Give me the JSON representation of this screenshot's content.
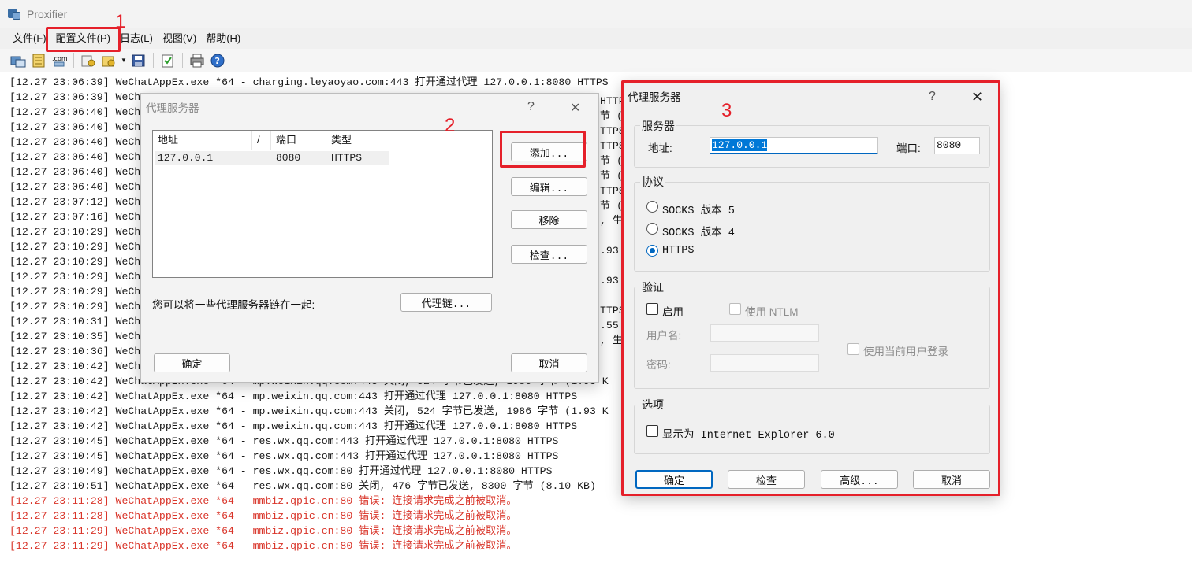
{
  "window": {
    "title": "Proxifier"
  },
  "menu": [
    "文件(F)",
    "配置文件(P)",
    "日志(L)",
    "视图(V)",
    "帮助(H)"
  ],
  "toolbar": [
    "new-profile-icon",
    "open-profile-icon",
    "domain-icon",
    "proxy-settings-icon",
    "rules-icon",
    "save-icon",
    "check-icon",
    "print-icon",
    "help-icon"
  ],
  "log": [
    {
      "t": "[12.27 23:06:39] WeChatAppEx.exe *64 - charging.leyaoyao.com:443 打开通过代理 127.0.0.1:8080 HTTPS",
      "err": false
    },
    {
      "t": "[12.27 23:06:39] WeCh",
      "err": false
    },
    {
      "t": "[12.27 23:06:40] WeCh",
      "err": false
    },
    {
      "t": "[12.27 23:06:40] WeCh",
      "err": false
    },
    {
      "t": "[12.27 23:06:40] WeCh",
      "err": false
    },
    {
      "t": "[12.27 23:06:40] WeCh",
      "err": false
    },
    {
      "t": "[12.27 23:06:40] WeCh",
      "err": false
    },
    {
      "t": "[12.27 23:06:40] WeCh",
      "err": false
    },
    {
      "t": "[12.27 23:07:12] WeCh",
      "err": false
    },
    {
      "t": "[12.27 23:07:16] WeCh",
      "err": false
    },
    {
      "t": "[12.27 23:10:29] WeCh",
      "err": false
    },
    {
      "t": "[12.27 23:10:29] WeCh",
      "err": false
    },
    {
      "t": "[12.27 23:10:29] WeCh",
      "err": false
    },
    {
      "t": "[12.27 23:10:29] WeCh",
      "err": false
    },
    {
      "t": "[12.27 23:10:29] WeCh",
      "err": false
    },
    {
      "t": "[12.27 23:10:29] WeCh",
      "err": false
    },
    {
      "t": "[12.27 23:10:31] WeCh",
      "err": false
    },
    {
      "t": "[12.27 23:10:35] WeCh",
      "err": false
    },
    {
      "t": "[12.27 23:10:36] WeCh",
      "err": false
    },
    {
      "t": "[12.27 23:10:42] WeCh",
      "err": false
    },
    {
      "t": "[12.27 23:10:42] WeChatAppEx.exe *64 - mp.weixin.qq.com:443 关闭, 524 字节已发送, 1986 字节 (1.93 K",
      "err": false
    },
    {
      "t": "[12.27 23:10:42] WeChatAppEx.exe *64 - mp.weixin.qq.com:443 打开通过代理 127.0.0.1:8080 HTTPS",
      "err": false
    },
    {
      "t": "[12.27 23:10:42] WeChatAppEx.exe *64 - mp.weixin.qq.com:443 关闭, 524 字节已发送, 1986 字节 (1.93 K",
      "err": false
    },
    {
      "t": "[12.27 23:10:42] WeChatAppEx.exe *64 - mp.weixin.qq.com:443 打开通过代理 127.0.0.1:8080 HTTPS",
      "err": false
    },
    {
      "t": "[12.27 23:10:45] WeChatAppEx.exe *64 - res.wx.qq.com:443 打开通过代理 127.0.0.1:8080 HTTPS",
      "err": false
    },
    {
      "t": "[12.27 23:10:45] WeChatAppEx.exe *64 - res.wx.qq.com:443 打开通过代理 127.0.0.1:8080 HTTPS",
      "err": false
    },
    {
      "t": "[12.27 23:10:49] WeChatAppEx.exe *64 - res.wx.qq.com:80 打开通过代理 127.0.0.1:8080 HTTPS",
      "err": false
    },
    {
      "t": "[12.27 23:10:51] WeChatAppEx.exe *64 - res.wx.qq.com:80 关闭, 476 字节已发送, 8300 字节 (8.10 KB)",
      "err": false
    },
    {
      "t": "[12.27 23:11:28] WeChatAppEx.exe *64 - mmbiz.qpic.cn:80 错误: 连接请求完成之前被取消。",
      "err": true
    },
    {
      "t": "[12.27 23:11:28] WeChatAppEx.exe *64 - mmbiz.qpic.cn:80 错误: 连接请求完成之前被取消。",
      "err": true
    },
    {
      "t": "[12.27 23:11:29] WeChatAppEx.exe *64 - mmbiz.qpic.cn:80 错误: 连接请求完成之前被取消。",
      "err": true
    },
    {
      "t": "[12.27 23:11:29] WeChatAppEx.exe *64 - mmbiz.qpic.cn:80 错误: 连接请求完成之前被取消。",
      "err": true
    }
  ],
  "log_fragments": [
    "HTTPS",
    "节 (1",
    "TTPS",
    "TTPS",
    "节 (1",
    "节 (1",
    "TTPS",
    "节 (1",
    ", 生",
    ".93 K",
    ".93 K",
    "TTPS",
    ".55",
    ", 生"
  ],
  "annotations": [
    "1",
    "2",
    "3"
  ],
  "proxy_list_dialog": {
    "title": "代理服务器",
    "help": "?",
    "close": "✕",
    "columns": [
      "地址",
      "/",
      "端口",
      "类型"
    ],
    "rows": [
      {
        "address": "127.0.0.1",
        "port": "8080",
        "type": "HTTPS"
      }
    ],
    "add": "添加...",
    "edit": "编辑...",
    "remove": "移除",
    "check": "检查...",
    "chain_text": "您可以将一些代理服务器链在一起:",
    "chain_btn": "代理链...",
    "ok": "确定",
    "cancel": "取消"
  },
  "proxy_server_dialog": {
    "title": "代理服务器",
    "help": "?",
    "close": "✕",
    "server_group": "服务器",
    "address_label": "地址:",
    "address_value": "127.0.0.1",
    "port_label": "端口:",
    "port_value": "8080",
    "protocol_group": "协议",
    "protocols": [
      {
        "label": "SOCKS 版本 5",
        "selected": false
      },
      {
        "label": "SOCKS 版本 4",
        "selected": false
      },
      {
        "label": "HTTPS",
        "selected": true
      }
    ],
    "auth_group": "验证",
    "enable": "启用",
    "use_ntlm": "使用 NTLM",
    "username_label": "用户名:",
    "password_label": "密码:",
    "use_current_user": "使用当前用户登录",
    "options_group": "选项",
    "show_as_ie": "显示为 Internet Explorer 6.0",
    "ok": "确定",
    "check": "检查",
    "advanced": "高级...",
    "cancel": "取消"
  },
  "colors": {
    "annotation": "#e5202a",
    "error_text": "#d9352a",
    "accent": "#0067c0"
  }
}
